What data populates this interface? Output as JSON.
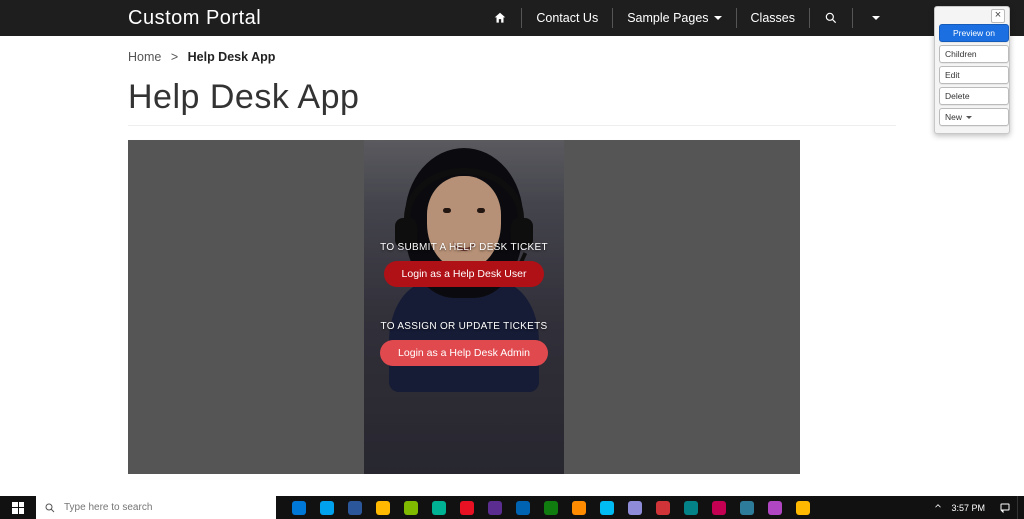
{
  "nav": {
    "brand": "Custom Portal",
    "items": {
      "contact": "Contact Us",
      "sample_pages": "Sample Pages",
      "classes": "Classes"
    }
  },
  "breadcrumb": {
    "home": "Home",
    "sep": ">",
    "current": "Help Desk App"
  },
  "page": {
    "title": "Help Desk App"
  },
  "hero": {
    "submit_label": "TO SUBMIT A HELP DESK TICKET",
    "login_user_btn": "Login as a Help Desk User",
    "assign_label": "TO ASSIGN OR UPDATE TICKETS",
    "login_admin_btn": "Login as a Help Desk Admin"
  },
  "admin_panel": {
    "preview": "Preview on",
    "children": "Children",
    "edit": "Edit",
    "delete": "Delete",
    "new": "New"
  },
  "taskbar": {
    "search_placeholder": "Type here to search",
    "clock_time": "3:57 PM",
    "app_colors": [
      "#0078d7",
      "#00a2ed",
      "#2b579a",
      "#ffb900",
      "#7fba00",
      "#00b294",
      "#e81123",
      "#5c2d91",
      "#0063b1",
      "#107c10",
      "#ff8c00",
      "#00bcf2",
      "#8e8cd8",
      "#d13438",
      "#038387",
      "#c30052",
      "#2d7d9a",
      "#b146c2",
      "#ffb900"
    ]
  }
}
